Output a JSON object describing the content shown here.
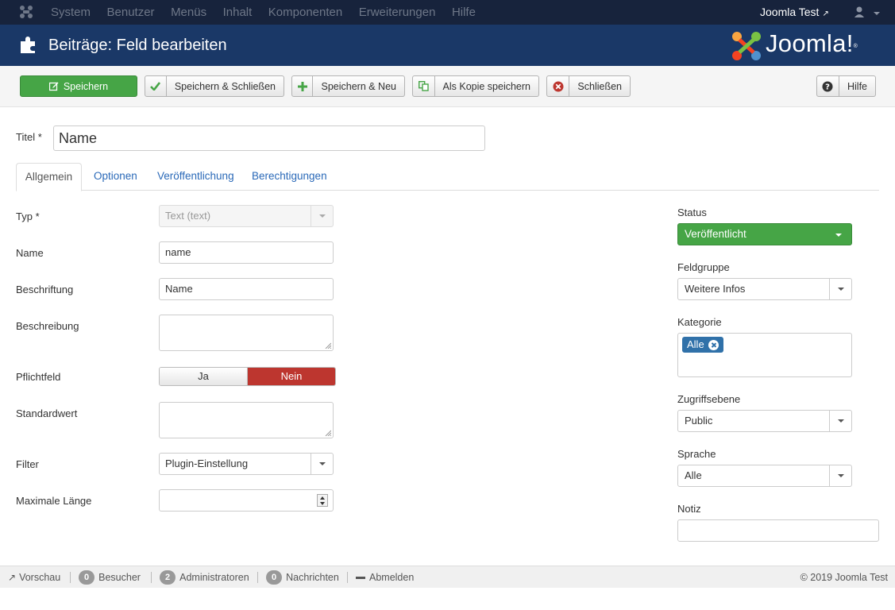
{
  "nav": {
    "menu": [
      "System",
      "Benutzer",
      "Menüs",
      "Inhalt",
      "Komponenten",
      "Erweiterungen",
      "Hilfe"
    ],
    "site_name": "Joomla Test",
    "user_icon": "user-icon"
  },
  "header": {
    "title": "Beiträge: Feld bearbeiten",
    "logo_text": "Joomla!",
    "logo_mark": "®"
  },
  "toolbar": {
    "save": "Speichern",
    "save_close": "Speichern & Schließen",
    "save_new": "Speichern & Neu",
    "save_copy": "Als Kopie speichern",
    "close": "Schließen",
    "help": "Hilfe"
  },
  "title_field": {
    "label": "Titel *",
    "value": "Name"
  },
  "tabs": [
    "Allgemein",
    "Optionen",
    "Veröffentlichung",
    "Berechtigungen"
  ],
  "form": {
    "type": {
      "label": "Typ *",
      "value": "Text (text)"
    },
    "name": {
      "label": "Name",
      "value": "name"
    },
    "caption": {
      "label": "Beschriftung",
      "value": "Name"
    },
    "description": {
      "label": "Beschreibung",
      "value": ""
    },
    "required": {
      "label": "Pflichtfeld",
      "yes": "Ja",
      "no": "Nein",
      "selected": "Nein"
    },
    "default": {
      "label": "Standardwert",
      "value": ""
    },
    "filter": {
      "label": "Filter",
      "value": "Plugin-Einstellung"
    },
    "maxlength": {
      "label": "Maximale Länge",
      "value": ""
    }
  },
  "sidebar": {
    "status": {
      "label": "Status",
      "value": "Veröffentlicht"
    },
    "group": {
      "label": "Feldgruppe",
      "value": "Weitere Infos"
    },
    "category": {
      "label": "Kategorie",
      "chip": "Alle"
    },
    "access": {
      "label": "Zugriffsebene",
      "value": "Public"
    },
    "language": {
      "label": "Sprache",
      "value": "Alle"
    },
    "note": {
      "label": "Notiz",
      "value": ""
    }
  },
  "statusbar": {
    "preview": "Vorschau",
    "visitors_count": "0",
    "visitors": "Besucher",
    "admins_count": "2",
    "admins": "Administratoren",
    "messages_count": "0",
    "messages": "Nachrichten",
    "logout": "Abmelden",
    "copyright": "© 2019 Joomla Test"
  },
  "colors": {
    "nav_bg": "#17233c",
    "header_bg": "#1a3867",
    "save_green": "#46a546",
    "no_red": "#bd362f",
    "link_blue": "#2a69b8",
    "chip_blue": "#3071a9"
  }
}
